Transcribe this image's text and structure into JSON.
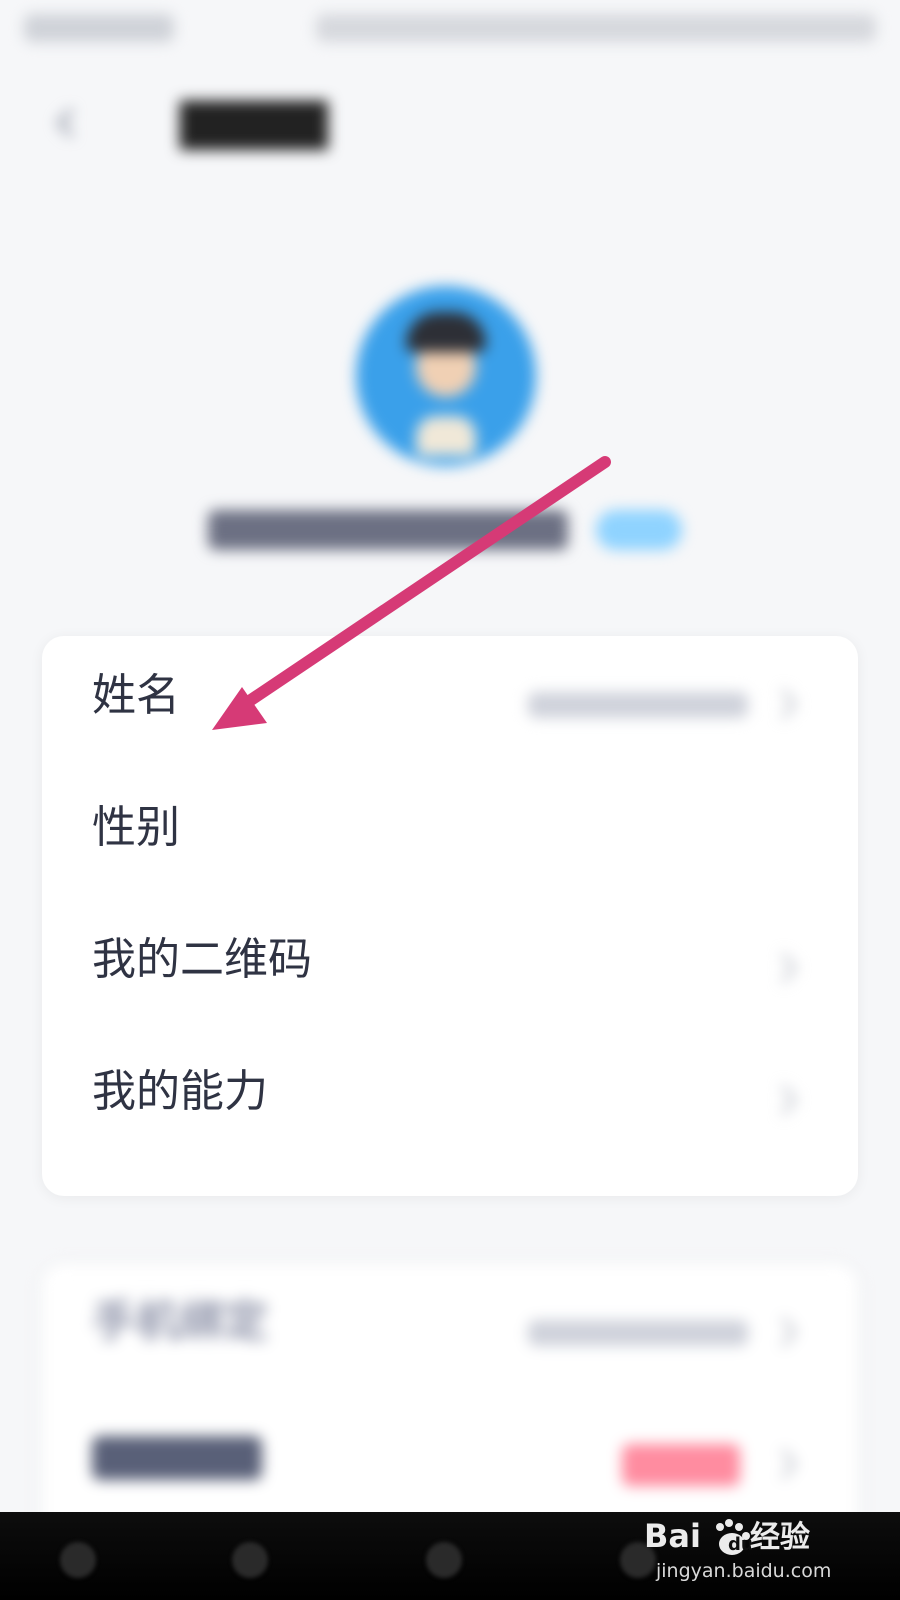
{
  "menu": {
    "items": [
      {
        "label": "姓名"
      },
      {
        "label": "性别"
      },
      {
        "label": "我的二维码"
      },
      {
        "label": "我的能力"
      }
    ]
  },
  "blurred": {
    "row_labels": [
      {
        "label": "手机绑定"
      },
      {
        "label": ""
      }
    ]
  },
  "watermark": {
    "logo_text": "Bai经验",
    "url": "jingyan.baidu.com"
  },
  "colors": {
    "arrow": "#d63a76",
    "label": "#2f3343",
    "badge_blue": "#8fd3ff",
    "badge_red": "#ff8ca0"
  }
}
